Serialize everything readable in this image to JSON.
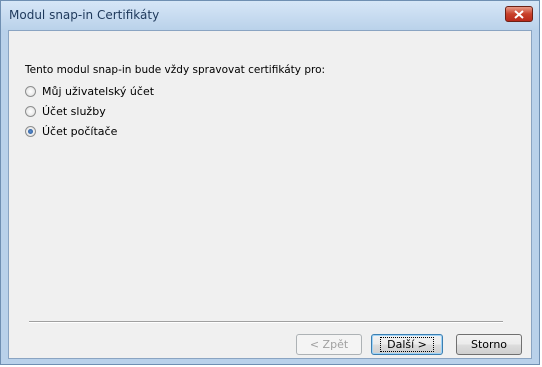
{
  "window": {
    "title": "Modul snap-in Certifikáty"
  },
  "content": {
    "prompt": "Tento modul snap-in bude vždy spravovat certifikáty pro:",
    "options": [
      {
        "label": "Můj uživatelský účet",
        "mnemonic": "M",
        "checked": false
      },
      {
        "label": "Účet služby",
        "mnemonic": "s",
        "checked": false
      },
      {
        "label": "Účet počítače",
        "mnemonic": "Ú",
        "checked": true
      }
    ]
  },
  "buttons": {
    "back": "< Zpět",
    "next": "Další >",
    "cancel": "Storno"
  }
}
